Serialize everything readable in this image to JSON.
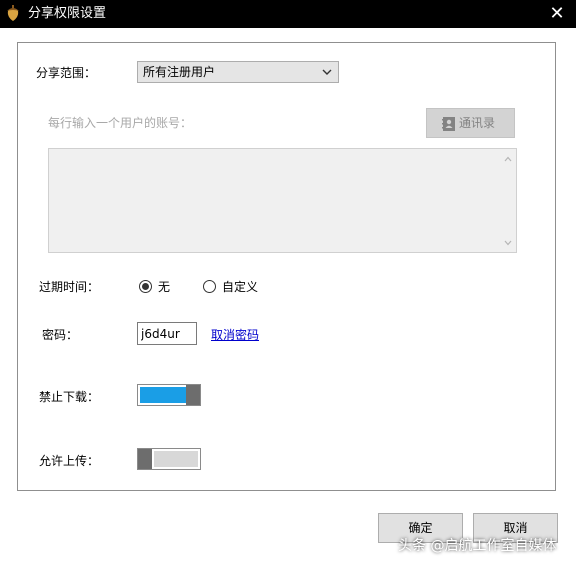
{
  "window": {
    "title": "分享权限设置",
    "close_glyph": "✕"
  },
  "share_scope": {
    "label": "分享范围：",
    "selected": "所有注册用户"
  },
  "accounts": {
    "hint": "每行输入一个用户的账号：",
    "contacts_button": "通讯录",
    "value": ""
  },
  "expiry": {
    "label": "过期时间：",
    "options": [
      {
        "label": "无",
        "selected": true
      },
      {
        "label": "自定义",
        "selected": false
      }
    ]
  },
  "password": {
    "label": "密码：",
    "value": "j6d4ur",
    "cancel_link": "取消密码"
  },
  "disable_download": {
    "label": "禁止下载：",
    "on": true
  },
  "allow_upload": {
    "label": "允许上传：",
    "on": false
  },
  "footer": {
    "ok": "确定",
    "cancel": "取消"
  },
  "watermark": "头条 @启航工作室自媒体",
  "colors": {
    "toggle_on": "#1a9ee6",
    "toggle_off": "#d8d8d8",
    "titlebar": "#000000"
  },
  "icons": {
    "app": "acorn-icon",
    "close": "close-icon",
    "dropdown": "chevron-down-icon",
    "contacts": "contacts-book-icon"
  }
}
